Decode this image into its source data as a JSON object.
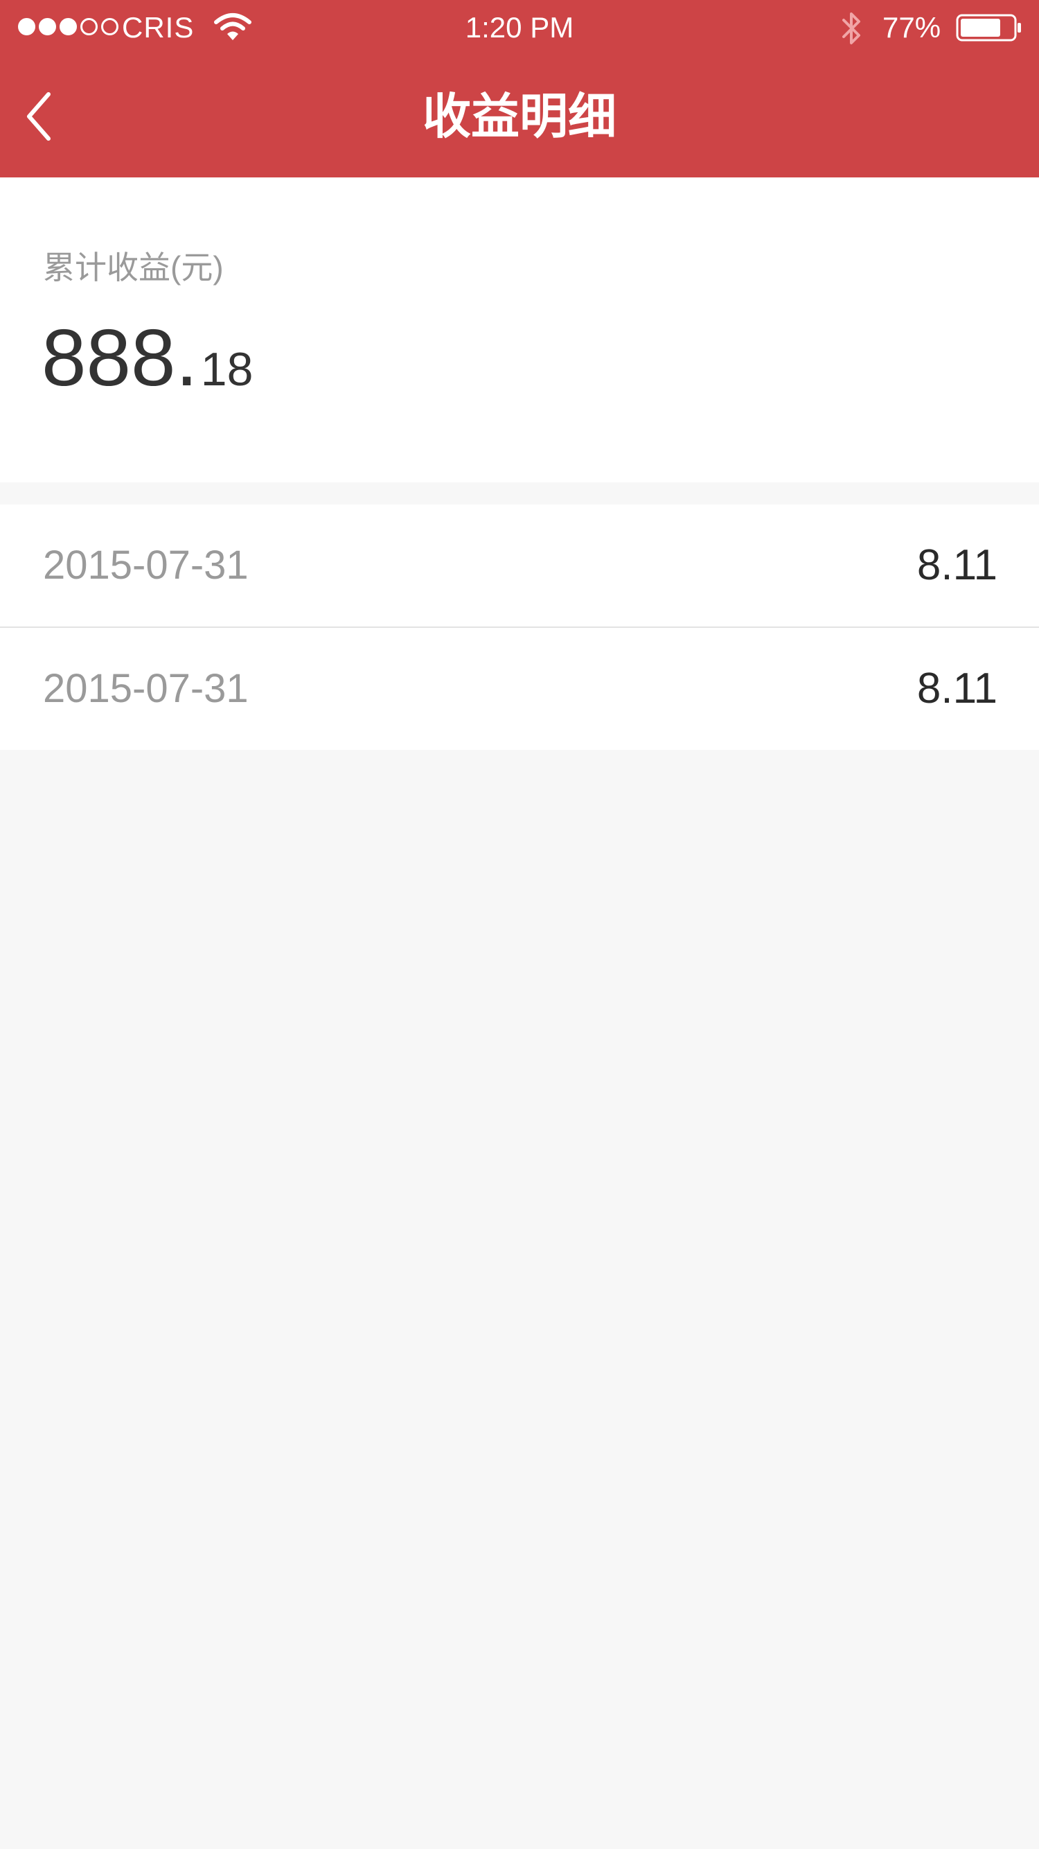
{
  "status_bar": {
    "carrier": "CRIS",
    "time": "1:20 PM",
    "battery_percent": "77%",
    "battery_level": 0.77,
    "signal_strength": 3,
    "signal_total": 5
  },
  "nav": {
    "title": "收益明细",
    "back_icon": "chevron-left-icon"
  },
  "summary": {
    "label": "累计收益(元)",
    "amount_integer": "888.",
    "amount_decimal": "18"
  },
  "records": [
    {
      "date": "2015-07-31",
      "amount": "8.11"
    },
    {
      "date": "2015-07-31",
      "amount": "8.11"
    }
  ],
  "colors": {
    "header_red": "#cd4446",
    "page_background": "#f7f7f7",
    "label_gray": "#9a9a9a",
    "value_dark": "#333333"
  }
}
